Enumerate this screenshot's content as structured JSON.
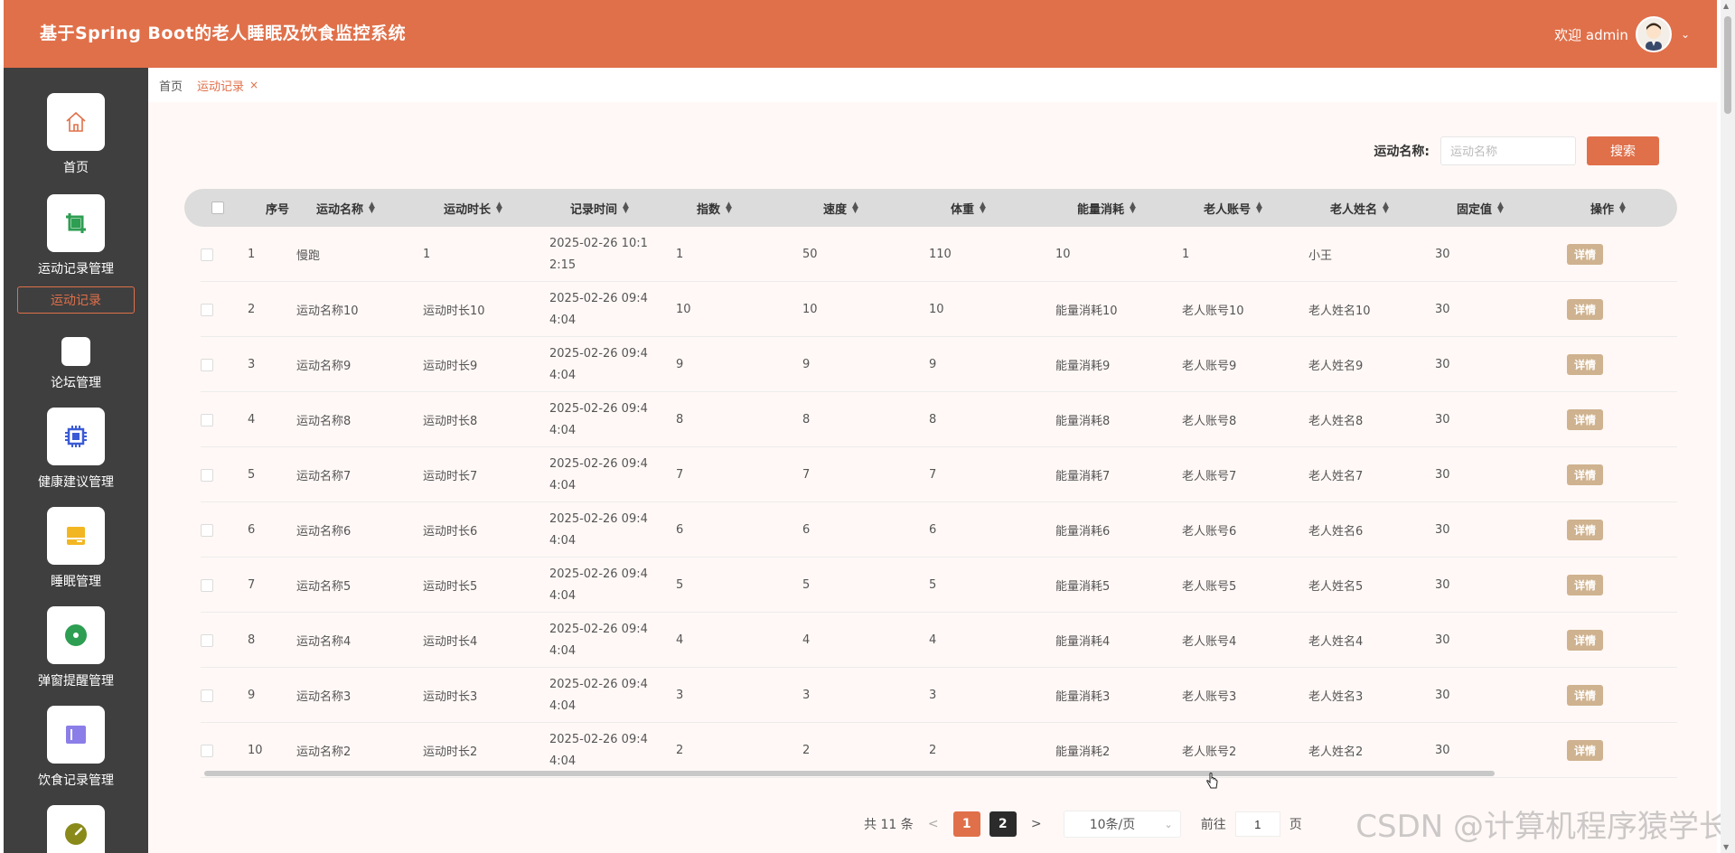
{
  "header": {
    "title": "基于Spring Boot的老人睡眠及饮食监控系统",
    "welcome": "欢迎 admin"
  },
  "sidebar": {
    "items": [
      {
        "label": "首页",
        "icon": "home-icon"
      },
      {
        "label": "运动记录管理",
        "icon": "crop-icon",
        "color": "#2e9e52"
      },
      {
        "label": "论坛管理",
        "icon": "forum-icon"
      },
      {
        "label": "健康建议管理",
        "icon": "chip-icon",
        "color": "#3b5bd6"
      },
      {
        "label": "睡眠管理",
        "icon": "bed-icon",
        "color": "#f3b623"
      },
      {
        "label": "弹窗提醒管理",
        "icon": "record-icon",
        "color": "#2e9e52"
      },
      {
        "label": "饮食记录管理",
        "icon": "panel-icon",
        "color": "#8b7ee8"
      },
      {
        "label": "",
        "icon": "gauge-icon",
        "color": "#8a8a1a"
      }
    ],
    "submenu_active": "运动记录"
  },
  "tabs": {
    "home": "首页",
    "active": "运动记录",
    "close": "×"
  },
  "search": {
    "label": "运动名称:",
    "placeholder": "运动名称",
    "button": "搜索"
  },
  "table": {
    "headers": [
      "序号",
      "运动名称",
      "运动时长",
      "记录时间",
      "指数",
      "速度",
      "体重",
      "能量消耗",
      "老人账号",
      "老人姓名",
      "固定值",
      "操作"
    ],
    "rows": [
      {
        "no": "1",
        "name": "慢跑",
        "duration": "1",
        "time": "2025-02-26 10:12:15",
        "index": "1",
        "speed": "50",
        "weight": "110",
        "energy": "10",
        "account": "1",
        "elder": "小王",
        "fixed": "30",
        "action": "详情"
      },
      {
        "no": "2",
        "name": "运动名称10",
        "duration": "运动时长10",
        "time": "2025-02-26 09:44:04",
        "index": "10",
        "speed": "10",
        "weight": "10",
        "energy": "能量消耗10",
        "account": "老人账号10",
        "elder": "老人姓名10",
        "fixed": "30",
        "action": "详情"
      },
      {
        "no": "3",
        "name": "运动名称9",
        "duration": "运动时长9",
        "time": "2025-02-26 09:44:04",
        "index": "9",
        "speed": "9",
        "weight": "9",
        "energy": "能量消耗9",
        "account": "老人账号9",
        "elder": "老人姓名9",
        "fixed": "30",
        "action": "详情"
      },
      {
        "no": "4",
        "name": "运动名称8",
        "duration": "运动时长8",
        "time": "2025-02-26 09:44:04",
        "index": "8",
        "speed": "8",
        "weight": "8",
        "energy": "能量消耗8",
        "account": "老人账号8",
        "elder": "老人姓名8",
        "fixed": "30",
        "action": "详情"
      },
      {
        "no": "5",
        "name": "运动名称7",
        "duration": "运动时长7",
        "time": "2025-02-26 09:44:04",
        "index": "7",
        "speed": "7",
        "weight": "7",
        "energy": "能量消耗7",
        "account": "老人账号7",
        "elder": "老人姓名7",
        "fixed": "30",
        "action": "详情"
      },
      {
        "no": "6",
        "name": "运动名称6",
        "duration": "运动时长6",
        "time": "2025-02-26 09:44:04",
        "index": "6",
        "speed": "6",
        "weight": "6",
        "energy": "能量消耗6",
        "account": "老人账号6",
        "elder": "老人姓名6",
        "fixed": "30",
        "action": "详情"
      },
      {
        "no": "7",
        "name": "运动名称5",
        "duration": "运动时长5",
        "time": "2025-02-26 09:44:04",
        "index": "5",
        "speed": "5",
        "weight": "5",
        "energy": "能量消耗5",
        "account": "老人账号5",
        "elder": "老人姓名5",
        "fixed": "30",
        "action": "详情"
      },
      {
        "no": "8",
        "name": "运动名称4",
        "duration": "运动时长4",
        "time": "2025-02-26 09:44:04",
        "index": "4",
        "speed": "4",
        "weight": "4",
        "energy": "能量消耗4",
        "account": "老人账号4",
        "elder": "老人姓名4",
        "fixed": "30",
        "action": "详情"
      },
      {
        "no": "9",
        "name": "运动名称3",
        "duration": "运动时长3",
        "time": "2025-02-26 09:44:04",
        "index": "3",
        "speed": "3",
        "weight": "3",
        "energy": "能量消耗3",
        "account": "老人账号3",
        "elder": "老人姓名3",
        "fixed": "30",
        "action": "详情"
      },
      {
        "no": "10",
        "name": "运动名称2",
        "duration": "运动时长2",
        "time": "2025-02-26 09:44:04",
        "index": "2",
        "speed": "2",
        "weight": "2",
        "energy": "能量消耗2",
        "account": "老人账号2",
        "elder": "老人姓名2",
        "fixed": "30",
        "action": "详情"
      }
    ]
  },
  "pagination": {
    "total": "共 11 条",
    "prev": "<",
    "next": ">",
    "pages": [
      "1",
      "2"
    ],
    "current": "1",
    "page_size": "10条/页",
    "goto": "前往",
    "goto_value": "1",
    "page_suffix": "页"
  },
  "watermark": "CSDN @计算机程序猿学长",
  "colors": {
    "primary": "#e0704a",
    "sidebar": "#3f3f3f",
    "detail_button": "#cfb28f"
  }
}
